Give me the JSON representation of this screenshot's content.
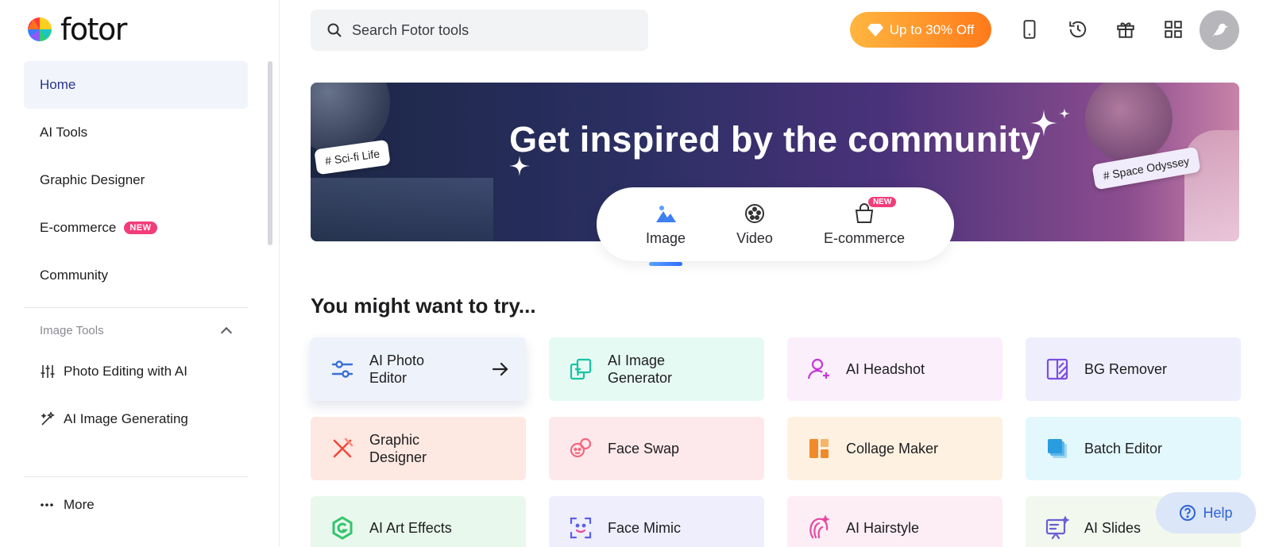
{
  "brand": {
    "name": "fotor"
  },
  "sidebar": {
    "nav": [
      {
        "label": "Home",
        "active": true
      },
      {
        "label": "AI Tools"
      },
      {
        "label": "Graphic Designer"
      },
      {
        "label": "E-commerce",
        "badge": "NEW"
      },
      {
        "label": "Community"
      }
    ],
    "section": {
      "label": "Image Tools",
      "expanded": true
    },
    "tools": [
      {
        "label": "Photo Editing with AI",
        "icon": "sliders-icon"
      },
      {
        "label": "AI Image Generating",
        "icon": "magic-wand-icon"
      }
    ],
    "more_label": "More"
  },
  "header": {
    "search_placeholder": "Search Fotor tools",
    "promo_label": "Up to 30% Off",
    "icons": [
      "mobile-icon",
      "history-icon",
      "gift-icon",
      "apps-grid-icon"
    ]
  },
  "banner": {
    "title": "Get inspired by the community",
    "tag_left": "# Sci-fi Life",
    "tag_right": "# Space Odyssey",
    "tabs": [
      {
        "label": "Image",
        "icon": "image-icon",
        "active": true
      },
      {
        "label": "Video",
        "icon": "film-reel-icon"
      },
      {
        "label": "E-commerce",
        "icon": "shopping-bag-icon",
        "badge": "NEW"
      }
    ]
  },
  "main": {
    "section_title": "You might want to try...",
    "cards": [
      {
        "label": "AI Photo Editor",
        "icon": "sliders-icon",
        "bg": "#eef2fb",
        "accent": "#3a6fd8"
      },
      {
        "label": "AI Image Generator",
        "icon": "ai-image-icon",
        "bg": "#e6faf4",
        "accent": "#19c3a3"
      },
      {
        "label": "AI Headshot",
        "icon": "headshot-icon",
        "bg": "#fbeffc",
        "accent": "#c536d6"
      },
      {
        "label": "BG Remover",
        "icon": "bg-remover-icon",
        "bg": "#efeefd",
        "accent": "#7a4fe0"
      },
      {
        "label": "Graphic Designer",
        "icon": "design-tools-icon",
        "bg": "#fde8e2",
        "accent": "#f04a3a"
      },
      {
        "label": "Face Swap",
        "icon": "face-swap-icon",
        "bg": "#fde9ec",
        "accent": "#f2677f"
      },
      {
        "label": "Collage Maker",
        "icon": "collage-icon",
        "bg": "#fef1e1",
        "accent": "#f08a2a"
      },
      {
        "label": "Batch Editor",
        "icon": "batch-layers-icon",
        "bg": "#e3f8fd",
        "accent": "#2a9de0"
      },
      {
        "label": "AI Art Effects",
        "icon": "art-effects-icon",
        "bg": "#e8f8ec",
        "accent": "#33c46e"
      },
      {
        "label": "Face Mimic",
        "icon": "face-mimic-icon",
        "bg": "#eeeefd",
        "accent": "#5b5fe6"
      },
      {
        "label": "AI Hairstyle",
        "icon": "hairstyle-icon",
        "bg": "#fdeef6",
        "accent": "#e64aa0"
      },
      {
        "label": "AI Slides",
        "icon": "slides-icon",
        "bg": "#f2f8ee",
        "accent": "#6a5fd6"
      }
    ]
  },
  "help_label": "Help"
}
